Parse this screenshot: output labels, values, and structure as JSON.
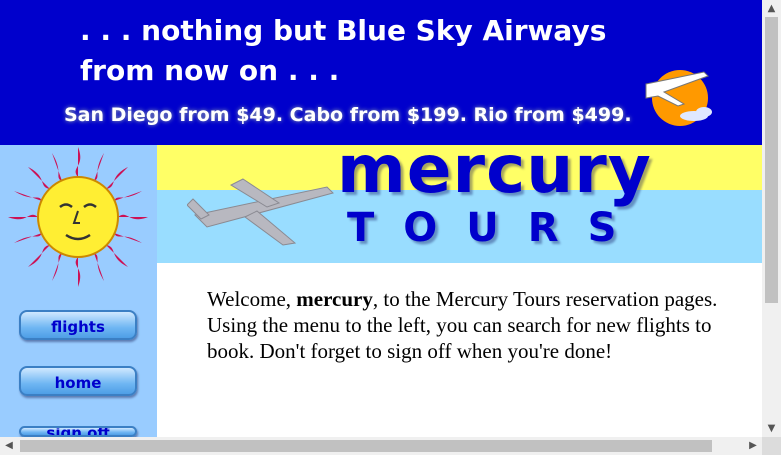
{
  "banner": {
    "line1": ". . . nothing but Blue Sky Airways",
    "line2": "from now on . . .",
    "promo": "San Diego from $49. Cabo from $199. Rio from $499.",
    "logo_icon": "airplane-sun-icon"
  },
  "header": {
    "brand_top": "mercury",
    "brand_bottom": "TOURS",
    "plane_icon": "airplane-icon"
  },
  "sidebar": {
    "sun_icon": "sun-face-icon",
    "buttons": [
      {
        "label": "flights"
      },
      {
        "label": "home"
      },
      {
        "label": "sign off"
      }
    ]
  },
  "content": {
    "welcome_prefix": "Welcome, ",
    "username": "mercury",
    "welcome_suffix": ", to the Mercury Tours reservation pages. Using the menu to the left, you can search for new flights to book. Don't forget to sign off when you're done!"
  },
  "colors": {
    "banner_bg": "#0000cc",
    "sidebar_bg": "#99ccff",
    "header_yellow": "#ffff66",
    "header_blue": "#99ddff",
    "brand_text": "#0000cc"
  }
}
